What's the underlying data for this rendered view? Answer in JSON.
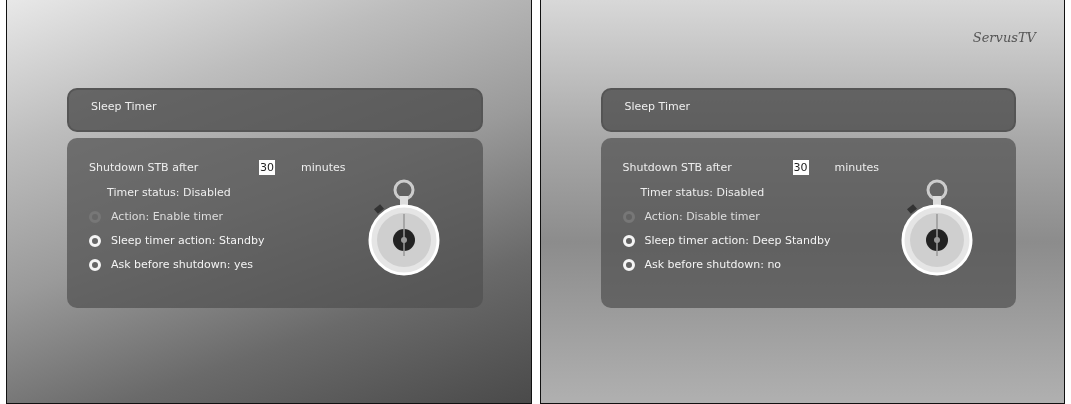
{
  "screens": [
    {
      "title": "Sleep Timer",
      "shutdown": {
        "label": "Shutdown STB after",
        "value": "30",
        "unit": "minutes"
      },
      "status": "Timer status: Disabled",
      "options": [
        {
          "label": "Action: Enable timer",
          "disabled": true
        },
        {
          "label": "Sleep timer action: Standby",
          "disabled": false
        },
        {
          "label": "Ask before shutdown: yes",
          "disabled": false
        }
      ]
    },
    {
      "logo": "ServusTV",
      "title": "Sleep Timer",
      "shutdown": {
        "label": "Shutdown STB after",
        "value": "30",
        "unit": "minutes"
      },
      "status": "Timer status: Disabled",
      "options": [
        {
          "label": "Action: Disable timer",
          "disabled": true
        },
        {
          "label": "Sleep timer action: Deep Standby",
          "disabled": false
        },
        {
          "label": "Ask before shutdown: no",
          "disabled": false
        }
      ]
    }
  ]
}
